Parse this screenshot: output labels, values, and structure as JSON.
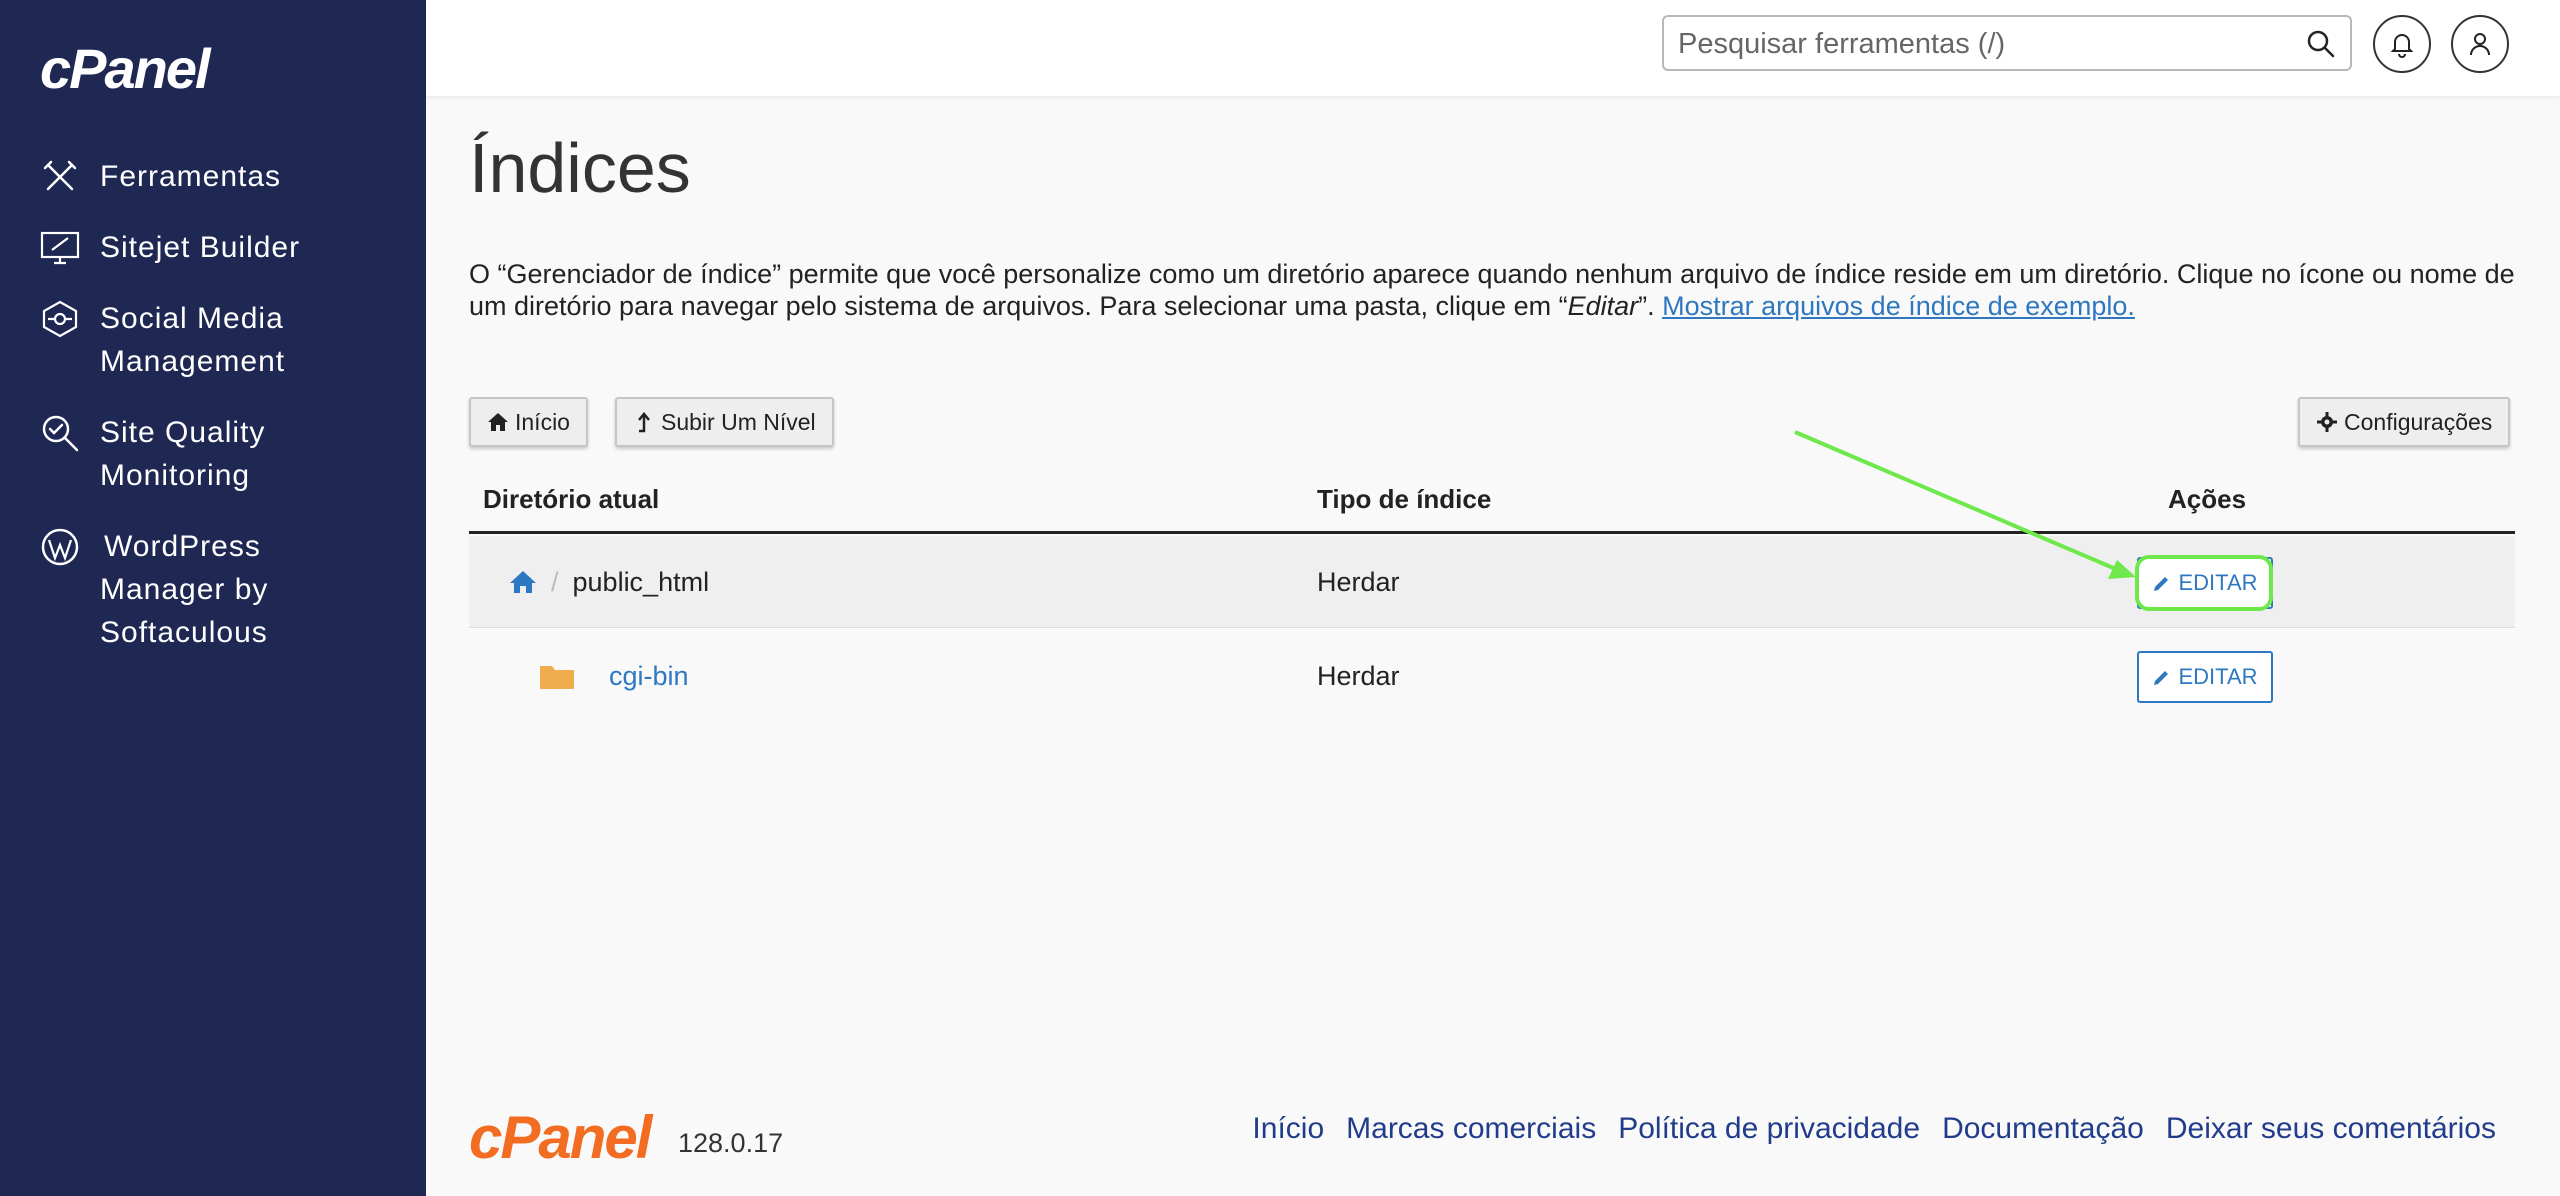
{
  "sidebar": {
    "logo": "cPanel",
    "items": [
      {
        "label": "Ferramentas",
        "icon": "tools-icon"
      },
      {
        "label": "Sitejet Builder",
        "icon": "monitor-icon"
      },
      {
        "label": "Social Media Management",
        "icon": "social-icon"
      },
      {
        "label": "Site Quality Monitoring",
        "icon": "quality-search-icon"
      },
      {
        "label": "WordPress Manager by Softaculous",
        "icon": "wordpress-icon"
      }
    ]
  },
  "topbar": {
    "search_placeholder": "Pesquisar ferramentas (/)"
  },
  "page": {
    "title": "Índices",
    "desc_part1": "O “Gerenciador de índice” permite que você personalize como um diretório aparece quando nenhum arquivo de índice reside em um diretório. Clique no ícone ou nome de um diretório para navegar pelo sistema de arquivos. Para selecionar uma pasta, clique em “",
    "desc_italic": "Editar",
    "desc_part2": "”. ",
    "desc_link": "Mostrar arquivos de índice de exemplo."
  },
  "toolbar": {
    "home_label": "Início",
    "up_label": "Subir Um Nível",
    "settings_label": "Configurações"
  },
  "table": {
    "headers": [
      "Diretório atual",
      "Tipo de índice",
      "Ações"
    ],
    "rows": [
      {
        "name": "public_html",
        "type": "Herdar",
        "action": "EDITAR"
      },
      {
        "name": "cgi-bin",
        "type": "Herdar",
        "action": "EDITAR"
      }
    ]
  },
  "footer": {
    "logo": "cPanel",
    "version": "128.0.17",
    "links": [
      "Início",
      "Marcas comerciais",
      "Política de privacidade",
      "Documentação",
      "Deixar seus comentários"
    ]
  },
  "colors": {
    "sidebar_bg": "#1f2753",
    "link_blue": "#2e78c2",
    "highlight_green": "#6ee84a",
    "footer_orange": "#f26d21"
  }
}
